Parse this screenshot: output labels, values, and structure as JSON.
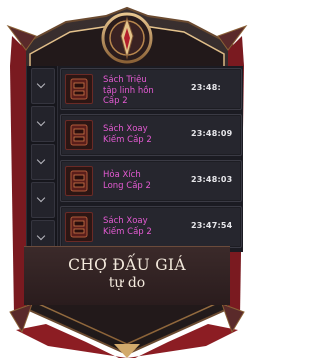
{
  "auction": {
    "items": [
      {
        "name": "Sách Triệu\ntập linh hồn\nCấp 2",
        "time": "23:48:"
      },
      {
        "name": "Sách Xoay\nKiếm Cấp 2",
        "time": "23:48:09"
      },
      {
        "name": "Hỏa Xích\nLong Cấp 2",
        "time": "23:48:03"
      },
      {
        "name": "Sách Xoay\nKiếm Cấp 2",
        "time": "23:47:54"
      }
    ]
  },
  "banner": {
    "title_line1": "CHỢ ĐẤU GIÁ",
    "title_line2": "tự do"
  },
  "colors": {
    "item_name": "#e45bd3",
    "frame_dark": "#2a2020",
    "frame_gold": "#c79a5a",
    "frame_red": "#8c1d23"
  }
}
